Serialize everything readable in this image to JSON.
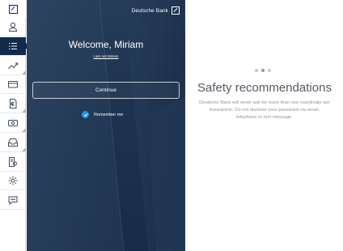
{
  "sidebar": {
    "logo_icon": "deutsche-bank-logo-icon",
    "items": [
      {
        "icon": "user-icon",
        "active": false
      },
      {
        "icon": "list-icon",
        "active": true
      },
      {
        "icon": "trend-chart-icon",
        "active": false
      },
      {
        "icon": "credit-card-icon",
        "active": false
      },
      {
        "icon": "euro-document-icon",
        "active": false
      },
      {
        "icon": "cash-icon",
        "active": false
      },
      {
        "icon": "inbox-icon",
        "active": false
      },
      {
        "icon": "settings-document-icon",
        "active": false
      },
      {
        "icon": "gear-icon",
        "active": false
      },
      {
        "icon": "chat-bubble-icon",
        "active": false
      }
    ]
  },
  "login": {
    "brand_name": "Deutsche Bank",
    "welcome": "Welcome, Miriam",
    "not_me_link": "I am not Miriam",
    "continue_label": "Continue",
    "remember_label": "Remember me",
    "remember_checked": true
  },
  "info": {
    "title": "Safety recommendations",
    "text": "Deutsche Bank will never ask for more than one coordinate per transaction. Do not disclose your password via email, telephone or text message.",
    "carousel_dots": 3,
    "carousel_active": 1
  },
  "colors": {
    "brand_blue": "#0018a8",
    "nav_active": "#0f2a4a",
    "checkbox": "#1f96e0",
    "panel_bg": "#223a57"
  }
}
